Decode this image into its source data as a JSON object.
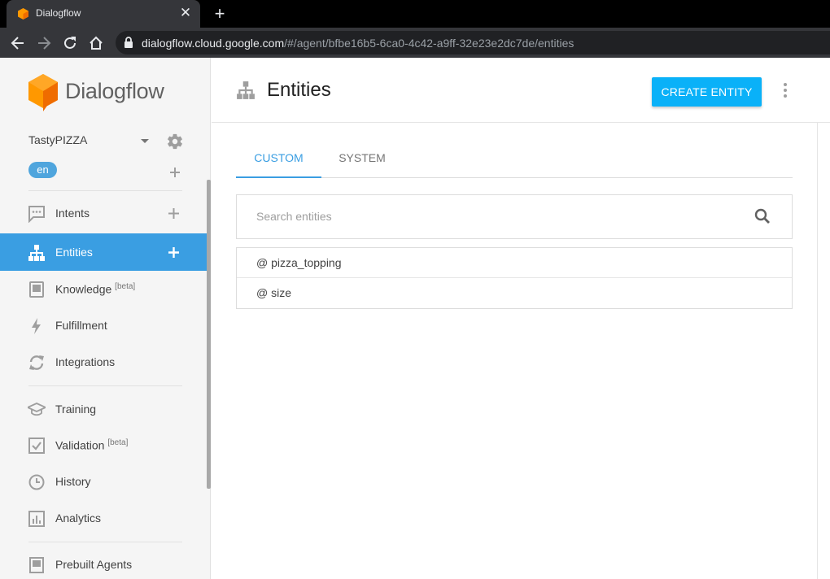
{
  "browser": {
    "tab_title": "Dialogflow",
    "url_host": "dialogflow.cloud.google.com",
    "url_path": "/#/agent/bfbe16b5-6ca0-4c42-a9ff-32e23e2dc7de/entities"
  },
  "sidebar": {
    "logo_text": "Dialogflow",
    "agent_name": "TastyPIZZA",
    "language": "en",
    "items": [
      {
        "label": "Intents",
        "icon": "intents-icon"
      },
      {
        "label": "Entities",
        "icon": "entities-icon"
      },
      {
        "label": "Knowledge",
        "badge": "[beta]",
        "icon": "knowledge-icon"
      },
      {
        "label": "Fulfillment",
        "icon": "fulfillment-icon"
      },
      {
        "label": "Integrations",
        "icon": "integrations-icon"
      },
      {
        "label": "Training",
        "icon": "training-icon"
      },
      {
        "label": "Validation",
        "badge": "[beta]",
        "icon": "validation-icon"
      },
      {
        "label": "History",
        "icon": "history-icon"
      },
      {
        "label": "Analytics",
        "icon": "analytics-icon"
      },
      {
        "label": "Prebuilt Agents",
        "icon": "prebuilt-agents-icon"
      }
    ],
    "active_item": "Entities"
  },
  "main": {
    "title": "Entities",
    "create_button": "CREATE ENTITY",
    "tabs": [
      {
        "label": "CUSTOM",
        "active": true
      },
      {
        "label": "SYSTEM",
        "active": false
      }
    ],
    "search": {
      "placeholder": "Search entities",
      "value": ""
    },
    "entities": [
      "@ pizza_topping",
      "@ size"
    ]
  },
  "colors": {
    "accent": "#3a9ee2",
    "button": "#0ab1f8",
    "logo_orange": "#ef6c00"
  }
}
